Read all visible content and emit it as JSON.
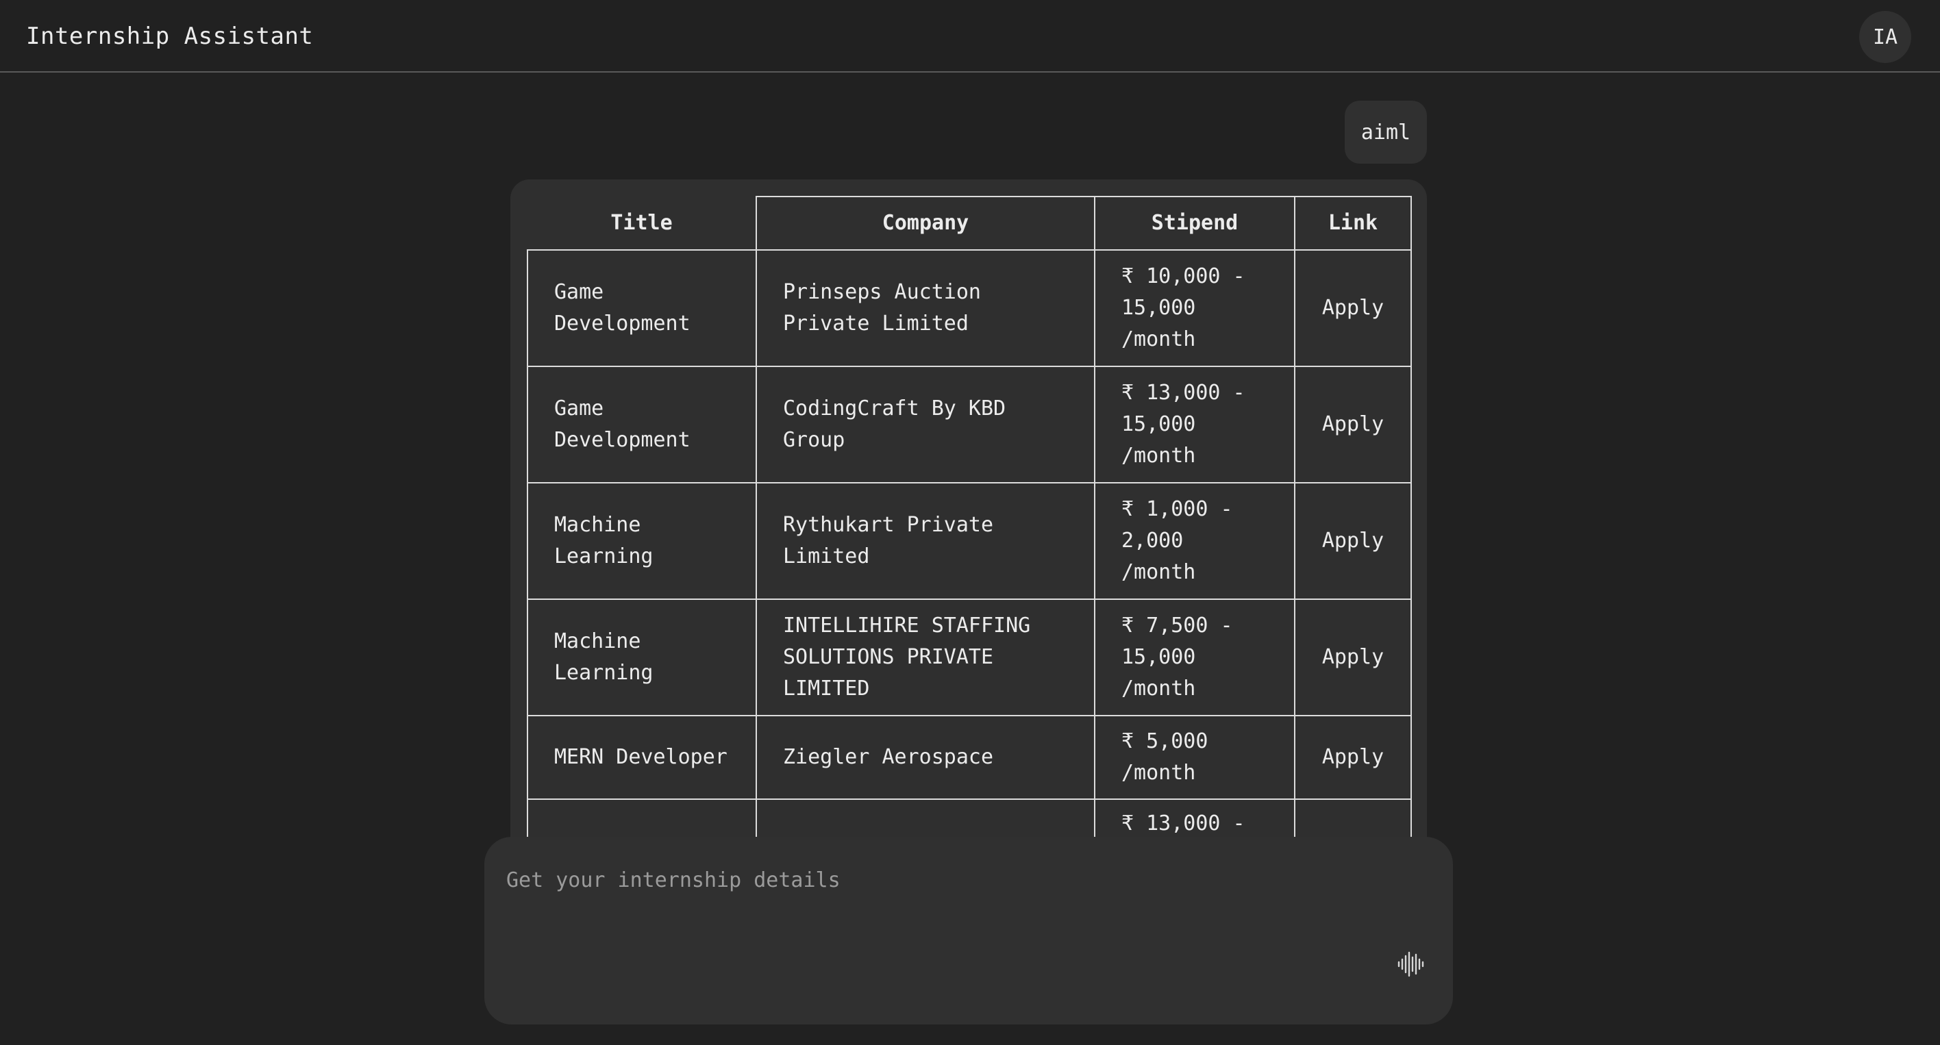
{
  "header": {
    "title": "Internship Assistant",
    "avatar_initials": "IA"
  },
  "conversation": {
    "user_message": "aiml",
    "results_table": {
      "columns": [
        "Title",
        "Company",
        "Stipend",
        "Link"
      ],
      "rows": [
        {
          "title": "Game Development",
          "company": "Prinseps Auction Private Limited",
          "stipend": "₹ 10,000 - 15,000 /month",
          "link": "Apply"
        },
        {
          "title": "Game Development",
          "company": "CodingCraft By KBD Group",
          "stipend": "₹ 13,000 - 15,000 /month",
          "link": "Apply"
        },
        {
          "title": "Machine Learning",
          "company": "Rythukart Private Limited",
          "stipend": "₹ 1,000 - 2,000 /month",
          "link": "Apply"
        },
        {
          "title": "Machine Learning",
          "company": "INTELLIHIRE STAFFING SOLUTIONS PRIVATE LIMITED",
          "stipend": "₹ 7,500 - 15,000 /month",
          "link": "Apply"
        },
        {
          "title": "MERN Developer",
          "company": "Ziegler Aerospace",
          "stipend": "₹ 5,000 /month",
          "link": "Apply"
        },
        {
          "title": "",
          "company": "",
          "stipend": "₹ 13,000 -",
          "link": ""
        }
      ]
    }
  },
  "composer": {
    "placeholder": "Get your internship details",
    "voice_icon": "voice-waveform-icon"
  },
  "colors": {
    "background": "#212121",
    "surface": "#303030",
    "text": "#ececec",
    "border": "#dcdcdc"
  }
}
